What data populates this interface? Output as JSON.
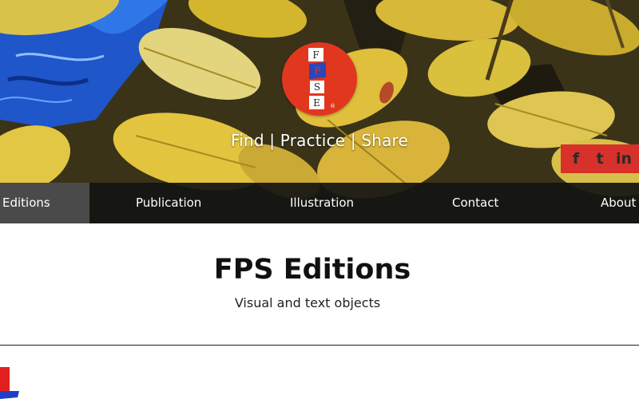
{
  "header": {
    "logo_letters": [
      "F",
      "P",
      "S",
      "E"
    ],
    "logo_mark": "®",
    "tagline": "Find | Practice | Share",
    "logo_colors": {
      "circle": "#e2371f",
      "tile": "#ffffff",
      "accent_tile": "#2b46b8"
    }
  },
  "social": {
    "background": "#d8302a",
    "icons": [
      {
        "name": "facebook-icon",
        "glyph": "f"
      },
      {
        "name": "twitter-icon",
        "glyph": "t"
      },
      {
        "name": "linkedin-icon",
        "glyph": "in"
      }
    ]
  },
  "nav": {
    "items": [
      {
        "label": "Editions",
        "active": true
      },
      {
        "label": "Publication",
        "active": false
      },
      {
        "label": "Illustration",
        "active": false
      },
      {
        "label": "Contact",
        "active": false
      },
      {
        "label": "About U",
        "active": false
      }
    ]
  },
  "main": {
    "title": "FPS Editions",
    "subtitle": "Visual and text objects"
  }
}
